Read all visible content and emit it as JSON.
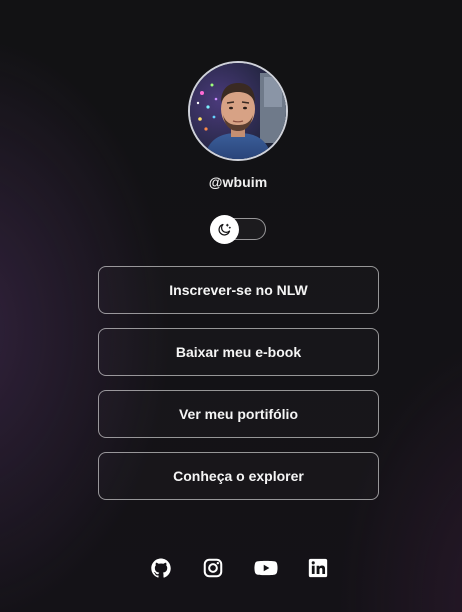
{
  "profile": {
    "username": "@wbuim"
  },
  "theme_switch": {
    "icon": "moon-icon",
    "state": "dark"
  },
  "links": [
    {
      "label": "Inscrever-se no NLW"
    },
    {
      "label": "Baixar meu e-book"
    },
    {
      "label": "Ver meu portifólio"
    },
    {
      "label": "Conheça o explorer"
    }
  ],
  "social": [
    {
      "icon": "github-icon"
    },
    {
      "icon": "instagram-icon"
    },
    {
      "icon": "youtube-icon"
    },
    {
      "icon": "linkedin-icon"
    }
  ],
  "colors": {
    "background": "#121214",
    "text": "#f5f5f5",
    "border": "#8a8a8e",
    "accent_glow": "#784696"
  }
}
